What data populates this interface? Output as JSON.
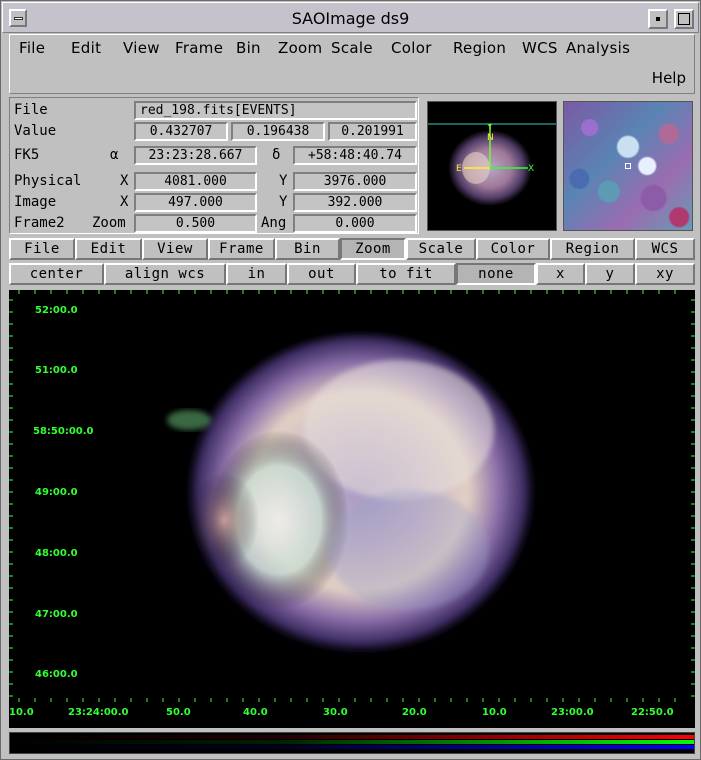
{
  "window": {
    "title": "SAOImage ds9"
  },
  "menu": {
    "items": [
      "File",
      "Edit",
      "View",
      "Frame",
      "Bin",
      "Zoom",
      "Scale",
      "Color",
      "Region",
      "WCS",
      "Analysis"
    ],
    "help": "Help"
  },
  "info": {
    "file_label": "File",
    "file_value": "red_198.fits[EVENTS]",
    "value_label": "Value",
    "values": [
      "0.432707",
      "0.196438",
      "0.201991"
    ],
    "fk5_label": "FK5",
    "alpha_symbol": "α",
    "alpha_value": "23:23:28.667",
    "delta_symbol": "δ",
    "delta_value": "+58:48:40.74",
    "physical_label": "Physical",
    "physical_x_label": "X",
    "physical_x": "4081.000",
    "physical_y_label": "Y",
    "physical_y": "3976.000",
    "image_label": "Image",
    "image_x_label": "X",
    "image_x": "497.000",
    "image_y_label": "Y",
    "image_y": "392.000",
    "frame_label": "Frame2",
    "zoom_label": "Zoom",
    "zoom_value": "0.500",
    "ang_label": "Ang",
    "ang_value": "0.000"
  },
  "panner": {
    "north_label": "N",
    "y_label": "Y",
    "east_label": "E",
    "x_label": "X"
  },
  "buttonbar1": [
    "File",
    "Edit",
    "View",
    "Frame",
    "Bin",
    "Zoom",
    "Scale",
    "Color",
    "Region",
    "WCS"
  ],
  "buttonbar1_active": "Zoom",
  "buttonbar2": [
    "center",
    "align wcs",
    "in",
    "out",
    "to fit",
    "none",
    "x",
    "y",
    "xy"
  ],
  "buttonbar2_active": "none",
  "frame": {
    "dec_labels": [
      "52:00.0",
      "51:00.0",
      "58:50:00.0",
      "49:00.0",
      "48:00.0",
      "47:00.0",
      "46:00.0"
    ],
    "ra_labels": [
      "10.0",
      "23:24:00.0",
      "50.0",
      "40.0",
      "30.0",
      "20.0",
      "10.0",
      "23:00.0",
      "22:50.0"
    ],
    "label_color": "#33ff33"
  }
}
